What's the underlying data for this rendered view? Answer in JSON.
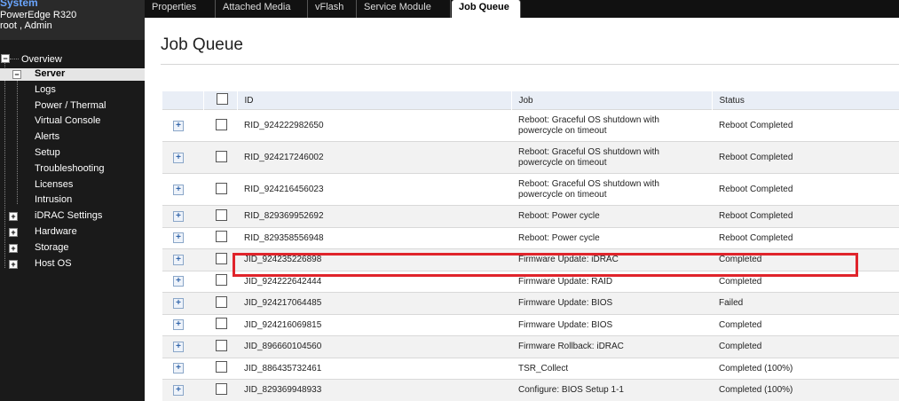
{
  "sidebar": {
    "system_title": "System",
    "model": "PowerEdge R320",
    "user": "root , Admin",
    "tree": [
      {
        "label": "Overview"
      },
      {
        "label": "Server"
      },
      {
        "label": "Logs"
      },
      {
        "label": "Power / Thermal"
      },
      {
        "label": "Virtual Console"
      },
      {
        "label": "Alerts"
      },
      {
        "label": "Setup"
      },
      {
        "label": "Troubleshooting"
      },
      {
        "label": "Licenses"
      },
      {
        "label": "Intrusion"
      },
      {
        "label": "iDRAC Settings"
      },
      {
        "label": "Hardware"
      },
      {
        "label": "Storage"
      },
      {
        "label": "Host OS"
      }
    ]
  },
  "tabs": [
    {
      "label": "Properties"
    },
    {
      "label": "Attached Media"
    },
    {
      "label": "vFlash"
    },
    {
      "label": "Service Module"
    },
    {
      "label": "Job Queue"
    }
  ],
  "active_tab": "Job Queue",
  "page_title": "Job Queue",
  "table": {
    "headers": {
      "id": "ID",
      "job": "Job",
      "status": "Status"
    },
    "rows": [
      {
        "id": "RID_924222982650",
        "job": "Reboot: Graceful OS shutdown with powercycle on timeout",
        "status": "Reboot Completed"
      },
      {
        "id": "RID_924217246002",
        "job": "Reboot: Graceful OS shutdown with powercycle on timeout",
        "status": "Reboot Completed"
      },
      {
        "id": "RID_924216456023",
        "job": "Reboot: Graceful OS shutdown with powercycle on timeout",
        "status": "Reboot Completed"
      },
      {
        "id": "RID_829369952692",
        "job": "Reboot: Power cycle",
        "status": "Reboot Completed"
      },
      {
        "id": "RID_829358556948",
        "job": "Reboot: Power cycle",
        "status": "Reboot Completed"
      },
      {
        "id": "JID_924235226898",
        "job": "Firmware Update: iDRAC",
        "status": "Completed"
      },
      {
        "id": "JID_924222642444",
        "job": "Firmware Update: RAID",
        "status": "Completed"
      },
      {
        "id": "JID_924217064485",
        "job": "Firmware Update: BIOS",
        "status": "Failed"
      },
      {
        "id": "JID_924216069815",
        "job": "Firmware Update: BIOS",
        "status": "Completed"
      },
      {
        "id": "JID_896660104560",
        "job": "Firmware Rollback: iDRAC",
        "status": "Completed"
      },
      {
        "id": "JID_886435732461",
        "job": "TSR_Collect",
        "status": "Completed (100%)"
      },
      {
        "id": "JID_829369948933",
        "job": "Configure: BIOS Setup 1-1",
        "status": "Completed (100%)"
      }
    ]
  },
  "colors": {
    "highlight": "#e0242b",
    "system_title": "#6aa6ff"
  }
}
